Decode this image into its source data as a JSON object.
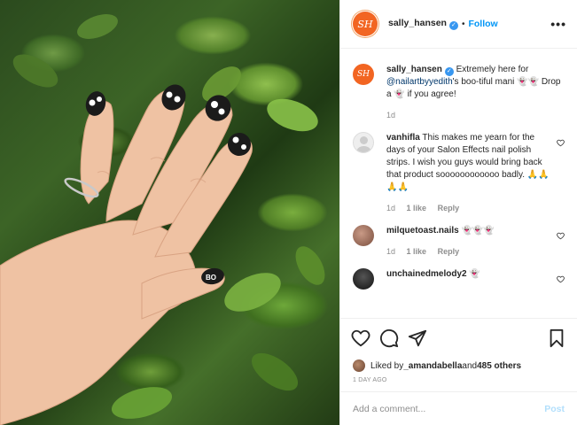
{
  "post": {
    "author": "sally_hansen",
    "avatar_initials": "SH",
    "follow_label": "Follow",
    "separator": "•",
    "more_label": "•••"
  },
  "caption": {
    "username": "sally_hansen",
    "text_before": " Extremely here for ",
    "mention": "@nailartbyyedith",
    "text_after": "'s boo-tiful mani 👻👻 Drop a 👻 if you agree!",
    "time": "1d"
  },
  "comments": [
    {
      "username": "vanhifla",
      "text": "This makes me yearn for the days of your Salon Effects nail polish strips. I wish you guys would bring back that product soooooooooooo badly. 🙏🙏🙏🙏",
      "time": "1d",
      "likes": "1 like",
      "reply": "Reply"
    },
    {
      "username": "milquetoast.nails",
      "text": "👻👻👻",
      "time": "1d",
      "likes": "1 like",
      "reply": "Reply"
    },
    {
      "username": "unchainedmelody2",
      "text": "👻",
      "time": "",
      "likes": "",
      "reply": ""
    }
  ],
  "likes": {
    "prefix": "Liked by ",
    "user": "_amandabella",
    "middle": " and ",
    "count": "485 others"
  },
  "date": "1 DAY AGO",
  "add_comment": {
    "placeholder": "Add a comment...",
    "post_label": "Post"
  },
  "icons": [
    "heart-icon",
    "comment-icon",
    "share-icon",
    "bookmark-icon",
    "verified-badge-icon",
    "more-options-icon"
  ],
  "colors": {
    "follow": "#0095f6",
    "avatar": "#f26522",
    "verified": "#3897f0",
    "post_disabled": "#b2dffc"
  }
}
